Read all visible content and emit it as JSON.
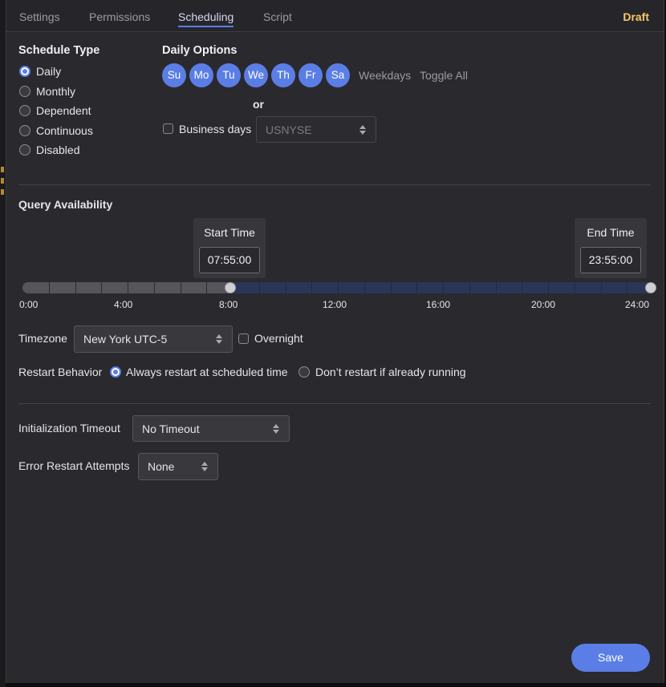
{
  "tabs": [
    {
      "label": "Settings"
    },
    {
      "label": "Permissions"
    },
    {
      "label": "Scheduling"
    },
    {
      "label": "Script"
    }
  ],
  "status": "Draft",
  "schedule_type": {
    "heading": "Schedule Type",
    "options": [
      "Daily",
      "Monthly",
      "Dependent",
      "Continuous",
      "Disabled"
    ],
    "selected": "Daily"
  },
  "daily_options": {
    "heading": "Daily Options",
    "days": [
      "Su",
      "Mo",
      "Tu",
      "We",
      "Th",
      "Fr",
      "Sa"
    ],
    "weekdays_label": "Weekdays",
    "toggle_all_label": "Toggle All",
    "or_label": "or",
    "business_days_label": "Business days",
    "business_days_checked": false,
    "calendar_value": "USNYSE"
  },
  "query_availability": {
    "heading": "Query Availability",
    "start_label": "Start Time",
    "start_value": "07:55:00",
    "end_label": "End Time",
    "end_value": "23:55:00",
    "ticks": [
      "0:00",
      "4:00",
      "8:00",
      "12:00",
      "16:00",
      "20:00",
      "24:00"
    ],
    "range_hours": [
      7.92,
      23.92
    ]
  },
  "timezone": {
    "label": "Timezone",
    "value": "New York UTC-5",
    "overnight_label": "Overnight",
    "overnight_checked": false
  },
  "restart": {
    "label": "Restart Behavior",
    "options": [
      "Always restart at scheduled time",
      "Don’t restart if already running"
    ],
    "selected": "Always restart at scheduled time"
  },
  "init_timeout": {
    "label": "Initialization Timeout",
    "value": "No Timeout"
  },
  "error_restart": {
    "label": "Error Restart Attempts",
    "value": "None"
  },
  "save_label": "Save",
  "colors": {
    "accent": "#5b7ee6",
    "draft": "#f5c969",
    "panel": "#2a2a2e"
  }
}
